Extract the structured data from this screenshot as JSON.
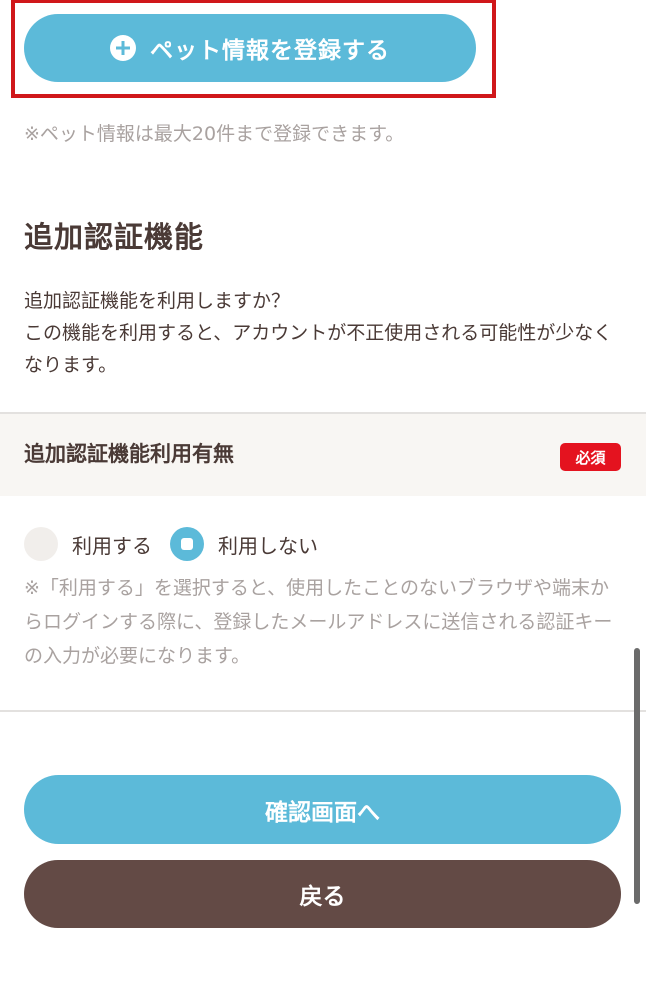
{
  "pet": {
    "add_button_label": "ペット情報を登録する",
    "add_button_icon": "plus-circle-icon",
    "limit_note": "※ペット情報は最大20件まで登録できます。"
  },
  "auth_section": {
    "title": "追加認証機能",
    "description_line1": "追加認証機能を利用しますか？",
    "description_line2": "この機能を利用すると、アカウントが不正使用される可能性が少なくなります。",
    "field_label": "追加認証機能利用有無",
    "required_badge": "必須",
    "options": [
      {
        "label": "利用する",
        "selected": false
      },
      {
        "label": "利用しない",
        "selected": true
      }
    ],
    "note": "※「利用する」を選択すると、使用したことのないブラウザや端末からログインする際に、登録したメールアドレスに送信される認証キーの入力が必要になります。"
  },
  "actions": {
    "confirm_label": "確認画面へ",
    "back_label": "戻る"
  },
  "colors": {
    "accent": "#5cbad9",
    "back_button": "#634a45",
    "required": "#e4131f",
    "highlight": "#d0171a"
  }
}
